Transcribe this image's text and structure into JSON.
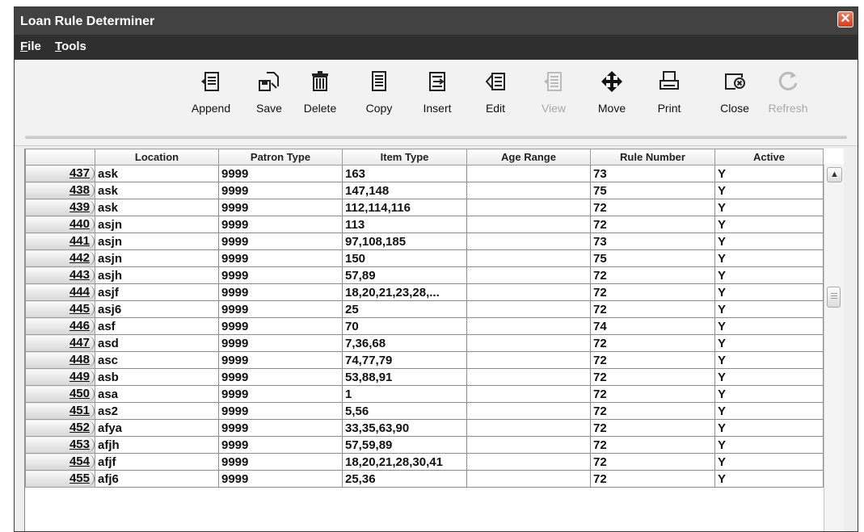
{
  "window": {
    "title": "Loan Rule Determiner"
  },
  "menu": [
    {
      "label": "File",
      "mnemonic": "F",
      "rest": "ile"
    },
    {
      "label": "Tools",
      "mnemonic": "T",
      "rest": "ools"
    }
  ],
  "toolbar": [
    {
      "label": "Append",
      "icon": "append-icon",
      "enabled": true
    },
    {
      "label": "Save",
      "icon": "save-icon",
      "enabled": true
    },
    {
      "label": "Delete",
      "icon": "trash-icon",
      "enabled": true
    },
    {
      "label": "Copy",
      "icon": "copy-icon",
      "enabled": true
    },
    {
      "label": "Insert",
      "icon": "insert-icon",
      "enabled": true
    },
    {
      "label": "Edit",
      "icon": "edit-icon",
      "enabled": true
    },
    {
      "label": "View",
      "icon": "view-icon",
      "enabled": false
    },
    {
      "label": "Move",
      "icon": "move-icon",
      "enabled": true
    },
    {
      "label": "Print",
      "icon": "print-icon",
      "enabled": true
    },
    {
      "label": "Close",
      "icon": "close-record-icon",
      "enabled": true
    },
    {
      "label": "Refresh",
      "icon": "refresh-icon",
      "enabled": false
    }
  ],
  "table": {
    "columns": [
      "Location",
      "Patron Type",
      "Item Type",
      "Age Range",
      "Rule Number",
      "Active"
    ],
    "rows": [
      {
        "num": "437",
        "location": "ask",
        "patron": "9999",
        "item": "163",
        "age": "",
        "rule": "73",
        "active": "Y"
      },
      {
        "num": "438",
        "location": "ask",
        "patron": "9999",
        "item": "147,148",
        "age": "",
        "rule": "75",
        "active": "Y"
      },
      {
        "num": "439",
        "location": "ask",
        "patron": "9999",
        "item": "112,114,116",
        "age": "",
        "rule": "72",
        "active": "Y"
      },
      {
        "num": "440",
        "location": "asjn",
        "patron": "9999",
        "item": "113",
        "age": "",
        "rule": "72",
        "active": "Y"
      },
      {
        "num": "441",
        "location": "asjn",
        "patron": "9999",
        "item": "97,108,185",
        "age": "",
        "rule": "73",
        "active": "Y"
      },
      {
        "num": "442",
        "location": "asjn",
        "patron": "9999",
        "item": "150",
        "age": "",
        "rule": "75",
        "active": "Y"
      },
      {
        "num": "443",
        "location": "asjh",
        "patron": "9999",
        "item": "57,89",
        "age": "",
        "rule": "72",
        "active": "Y"
      },
      {
        "num": "444",
        "location": "asjf",
        "patron": "9999",
        "item": "18,20,21,23,28,...",
        "age": "",
        "rule": "72",
        "active": "Y"
      },
      {
        "num": "445",
        "location": "asj6",
        "patron": "9999",
        "item": "25",
        "age": "",
        "rule": "72",
        "active": "Y"
      },
      {
        "num": "446",
        "location": "asf",
        "patron": "9999",
        "item": "70",
        "age": "",
        "rule": "74",
        "active": "Y"
      },
      {
        "num": "447",
        "location": "asd",
        "patron": "9999",
        "item": "7,36,68",
        "age": "",
        "rule": "72",
        "active": "Y"
      },
      {
        "num": "448",
        "location": "asc",
        "patron": "9999",
        "item": "74,77,79",
        "age": "",
        "rule": "72",
        "active": "Y"
      },
      {
        "num": "449",
        "location": "asb",
        "patron": "9999",
        "item": "53,88,91",
        "age": "",
        "rule": "72",
        "active": "Y"
      },
      {
        "num": "450",
        "location": "asa",
        "patron": "9999",
        "item": "1",
        "age": "",
        "rule": "72",
        "active": "Y"
      },
      {
        "num": "451",
        "location": "as2",
        "patron": "9999",
        "item": "5,56",
        "age": "",
        "rule": "72",
        "active": "Y"
      },
      {
        "num": "452",
        "location": "afya",
        "patron": "9999",
        "item": "33,35,63,90",
        "age": "",
        "rule": "72",
        "active": "Y"
      },
      {
        "num": "453",
        "location": "afjh",
        "patron": "9999",
        "item": "57,59,89",
        "age": "",
        "rule": "72",
        "active": "Y"
      },
      {
        "num": "454",
        "location": "afjf",
        "patron": "9999",
        "item": "18,20,21,28,30,41",
        "age": "",
        "rule": "72",
        "active": "Y"
      },
      {
        "num": "455",
        "location": "afj6",
        "patron": "9999",
        "item": "25,36",
        "age": "",
        "rule": "72",
        "active": "Y"
      }
    ]
  },
  "colors": {
    "titlebar": "#424242",
    "menubar": "#2f2f2f",
    "close": "#d63a1a"
  }
}
